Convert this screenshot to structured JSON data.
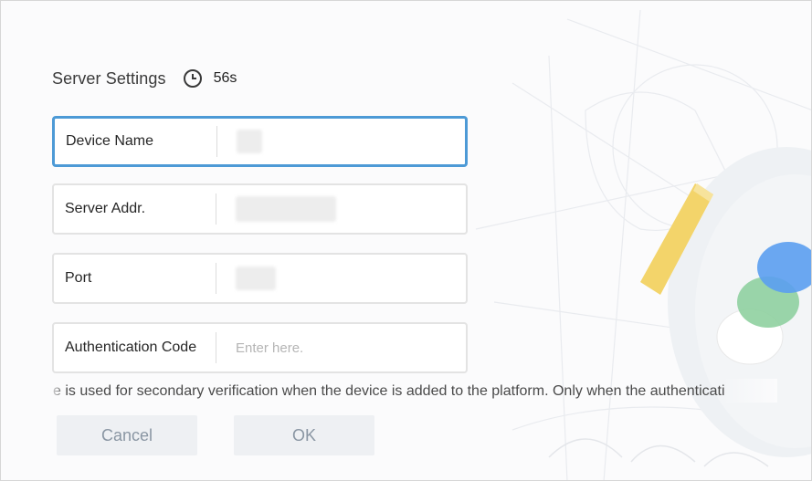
{
  "dialog": {
    "title": "Server Settings",
    "countdown": "56s"
  },
  "fields": [
    {
      "label": "Device Name",
      "value": "",
      "placeholder": "",
      "active": true
    },
    {
      "label": "Server Addr.",
      "value": "",
      "placeholder": ""
    },
    {
      "label": "Port",
      "value": "",
      "placeholder": ""
    },
    {
      "label": "Authentication Code",
      "value": "",
      "placeholder": "Enter here."
    }
  ],
  "hint": "e is used for secondary verification when the device is added to the platform. Only when the authenticati",
  "buttons": {
    "cancel": "Cancel",
    "ok": "OK"
  },
  "colors": {
    "active_border": "#4d9ad6",
    "button_bg": "#eef0f3",
    "button_text": "#8a96a3"
  },
  "icons": {
    "timer": "clock-icon"
  }
}
